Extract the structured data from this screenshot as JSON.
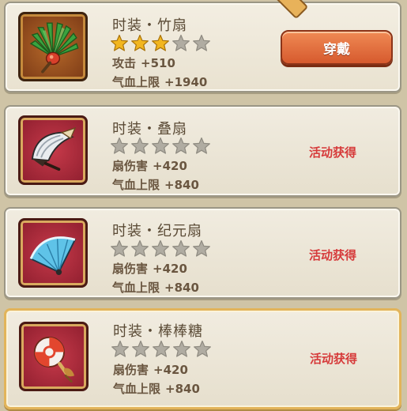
{
  "items": [
    {
      "name": "时装・竹扇",
      "stars_filled": 3,
      "stars_total": 5,
      "stat1_label": "攻击",
      "stat1_value": "+510",
      "stat2_label": "气血上限",
      "stat2_value": "+1940",
      "action": "穿戴",
      "action_type": "button",
      "icon": "bamboo-fan-icon"
    },
    {
      "name": "时装・叠扇",
      "stars_filled": 0,
      "stars_total": 5,
      "stat1_label": "扇伤害",
      "stat1_value": "+420",
      "stat2_label": "气血上限",
      "stat2_value": "+840",
      "action": "活动获得",
      "action_type": "text",
      "icon": "folding-fan-icon"
    },
    {
      "name": "时装・纪元扇",
      "stars_filled": 0,
      "stars_total": 5,
      "stat1_label": "扇伤害",
      "stat1_value": "+420",
      "stat2_label": "气血上限",
      "stat2_value": "+840",
      "action": "活动获得",
      "action_type": "text",
      "icon": "era-fan-icon"
    },
    {
      "name": "时装・棒棒糖",
      "stars_filled": 0,
      "stars_total": 5,
      "stat1_label": "扇伤害",
      "stat1_value": "+420",
      "stat2_label": "气血上限",
      "stat2_value": "+840",
      "action": "活动获得",
      "action_type": "text",
      "icon": "lollipop-icon"
    }
  ],
  "colors": {
    "star_filled": "#f2b61f",
    "star_empty": "#b0aca2",
    "acquire_text": "#d63a3a",
    "button": "#e2703e"
  }
}
